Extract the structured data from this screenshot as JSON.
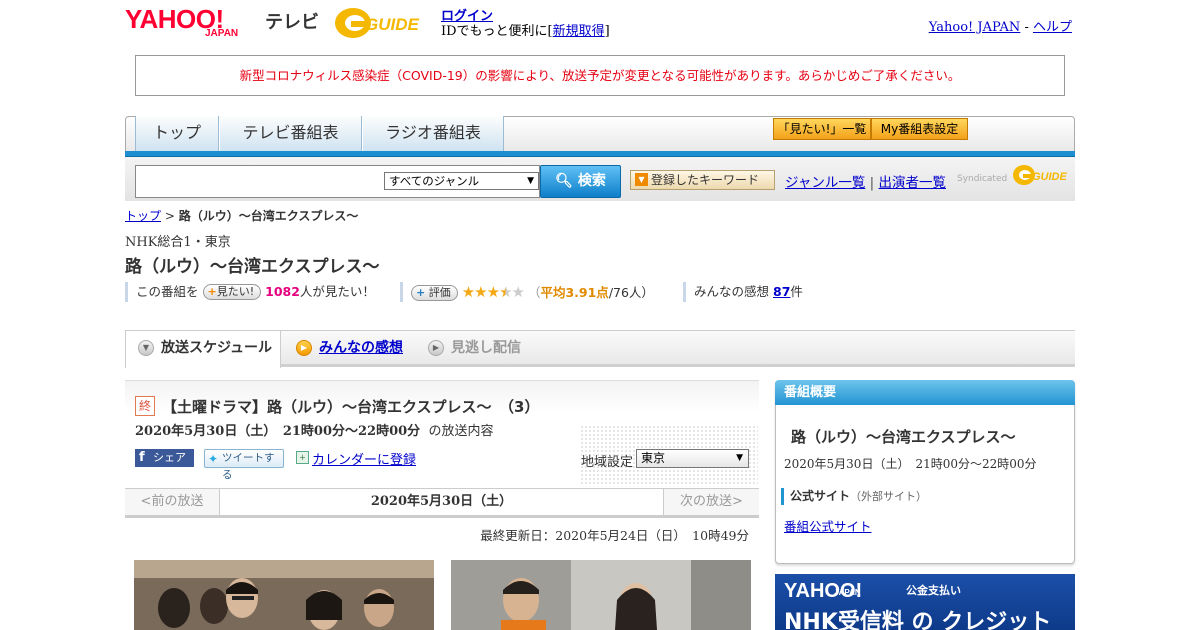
{
  "header": {
    "logo_text": "YAHOO!",
    "logo_sub": "JAPAN",
    "service": "テレビ",
    "gguide_logo": "GUIDE",
    "login_link": "ログイン",
    "login_sub_prefix": "IDでもっと便利に[",
    "signup_link": "新規取得",
    "login_sub_suffix": "]",
    "yahoo_link": "Yahoo! JAPAN",
    "sep": " - ",
    "help_link": "ヘルプ"
  },
  "notice": "新型コロナウィルス感染症（COVID-19）の影響により、放送予定が変更となる可能性があります。あらかじめご了承ください。",
  "nav": {
    "tabs": [
      "トップ",
      "テレビ番組表",
      "ラジオ番組表"
    ],
    "want_list": "「見たい!」一覧",
    "my_schedule": "My番組表設定"
  },
  "search": {
    "placeholder": "",
    "genre_selected": "すべてのジャンル",
    "button": "検索",
    "keyword_button": "登録したキーワード",
    "genre_list": "ジャンル一覧",
    "divider": "|",
    "cast_list": "出演者一覧",
    "syndicated": "Syndicated",
    "syndicated_logo": "GUIDE"
  },
  "breadcrumb": {
    "top": "トップ",
    "sep": " > ",
    "current": "路（ルウ）～台湾エクスプレス～"
  },
  "program": {
    "channel": "NHK総合1・東京",
    "title": "路（ルウ）～台湾エクスプレス～",
    "want_prefix": "この番組を",
    "want_button": "見たい!",
    "want_count": "1082",
    "want_suffix": "人が見たい！",
    "rate_button": "評価",
    "rating_stars": 3.5,
    "avg_open": "（",
    "avg_text": "平均3.91点",
    "avg_count": "/76人）",
    "review_prefix": "みんなの感想",
    "review_count": "87",
    "review_suffix": "件"
  },
  "tabs": {
    "schedule": "放送スケジュール",
    "reviews": "みんなの感想",
    "missed": "見逃し配信"
  },
  "episode": {
    "badge": "終",
    "title": "【土曜ドラマ】路（ルウ）～台湾エクスプレス～　（3）",
    "datetime": "2020年5月30日（土）　21時00分～22時00分",
    "datetime_suffix": "の放送内容",
    "share": "シェア",
    "tweet": "ツイートする",
    "calendar": "カレンダーに登録",
    "region_label": "地域設定",
    "region_value": "東京"
  },
  "daynav": {
    "prev": "<前の放送",
    "current": "2020年5月30日（土）",
    "next": "次の放送>"
  },
  "updated": "最終更新日：2020年5月24日（日）　10時49分",
  "sidebar": {
    "heading": "番組概要",
    "title": "路（ルウ）～台湾エクスプレス～",
    "time": "2020年5月30日（土）　21時00分～22時00分",
    "section_label": "公式サイト",
    "section_note": "（外部サイト）",
    "official_link": "番組公式サイト"
  },
  "ad": {
    "logo": "YAHOO!",
    "logo_sub": "JAPAN",
    "sub": "公金支払い",
    "main": "NHK受信料 の クレジット"
  },
  "colors": {
    "brand_red": "#ff0033",
    "accent_blue": "#1d8fd0",
    "notice_red": "#e60012",
    "star": "#f3a815"
  }
}
